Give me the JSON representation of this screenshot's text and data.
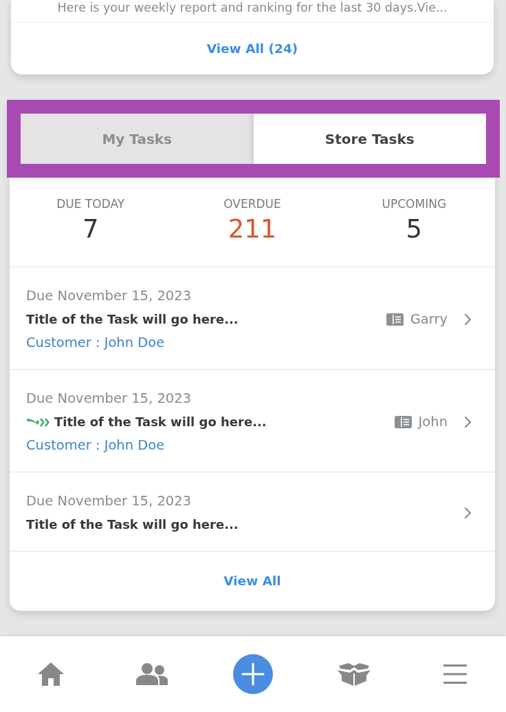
{
  "report_card": {
    "message": "Here is your weekly report and ranking for the last 30 days.Vie...",
    "view_all_link": "View All (24)"
  },
  "tasks_card": {
    "highlighted": true,
    "tabs": [
      {
        "label": "My Tasks",
        "selected": false
      },
      {
        "label": "Store Tasks",
        "selected": true
      }
    ],
    "stats": [
      {
        "label": "DUE TODAY",
        "value": "7",
        "kind": "normal"
      },
      {
        "label": "OVERDUE",
        "value": "211",
        "kind": "alert"
      },
      {
        "label": "UPCOMING",
        "value": "5",
        "kind": "normal"
      }
    ],
    "tasks": [
      {
        "due": "Due November 15, 2023",
        "title": "Title of the Task will go here...",
        "flagged": false,
        "assignee": "Garry",
        "customer": "Customer : John Doe"
      },
      {
        "due": "Due November 15, 2023",
        "title": "Title of the Task will go here...",
        "flagged": true,
        "assignee": "John",
        "customer": "Customer : John Doe"
      },
      {
        "due": "Due November 15, 2023",
        "title": "Title of the Task will go here...",
        "flagged": false
      }
    ],
    "view_all_link": "View All"
  }
}
